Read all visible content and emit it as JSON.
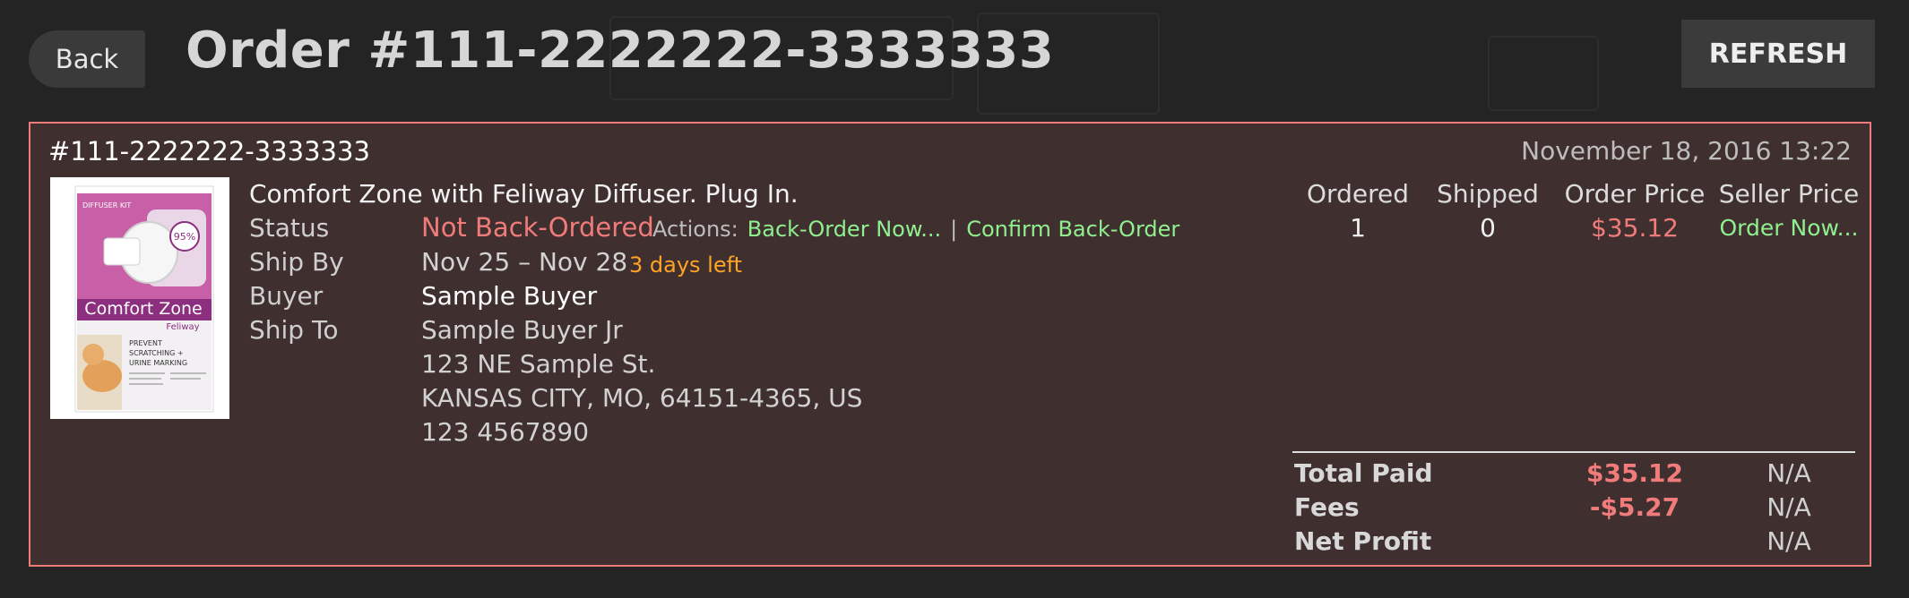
{
  "header": {
    "back_label": "Back",
    "title": "Order #111-2222222-3333333",
    "refresh_label": "REFRESH"
  },
  "order": {
    "number": "#111-2222222-3333333",
    "date": "November 18, 2016 13:22",
    "product_title": "Comfort Zone with Feliway Diffuser. Plug In.",
    "product_image": {
      "brand": "Comfort Zone",
      "sub_brand": "Feliway",
      "kit_label": "DIFFUSER KIT",
      "claim": "95%",
      "tagline_1": "PREVENT",
      "tagline_2": "SCRATCHING +",
      "tagline_3": "URINE MARKING"
    },
    "labels": {
      "status": "Status",
      "ship_by": "Ship By",
      "buyer": "Buyer",
      "ship_to": "Ship To"
    },
    "status": "Not Back-Ordered",
    "actions_label": "Actions:",
    "actions": [
      "Back-Order Now...",
      "Confirm Back-Order"
    ],
    "action_separator": "|",
    "ship_by": "Nov 25 – Nov 28",
    "days_left": "3 days left",
    "buyer": "Sample Buyer",
    "ship_to": [
      "Sample Buyer Jr",
      "123 NE Sample St.",
      "KANSAS CITY, MO, 64151-4365, US",
      "123 4567890"
    ]
  },
  "stats": {
    "headers": [
      "Ordered",
      "Shipped",
      "Order Price",
      "Seller Price"
    ],
    "ordered": "1",
    "shipped": "0",
    "order_price": "$35.12",
    "seller_price_action": "Order Now..."
  },
  "summary": {
    "rows": [
      {
        "label": "Total Paid",
        "order_value": "$35.12",
        "seller_value": "N/A"
      },
      {
        "label": "Fees",
        "order_value": "-$5.27",
        "seller_value": "N/A"
      },
      {
        "label": "Net Profit",
        "order_value": "",
        "seller_value": "N/A"
      }
    ]
  },
  "colors": {
    "background": "#242425",
    "card_background": "#402f2f",
    "card_border": "#f07b7b",
    "status_red": "#f07b7b",
    "action_green": "#8ff08f",
    "warning_orange": "#ffa326"
  }
}
